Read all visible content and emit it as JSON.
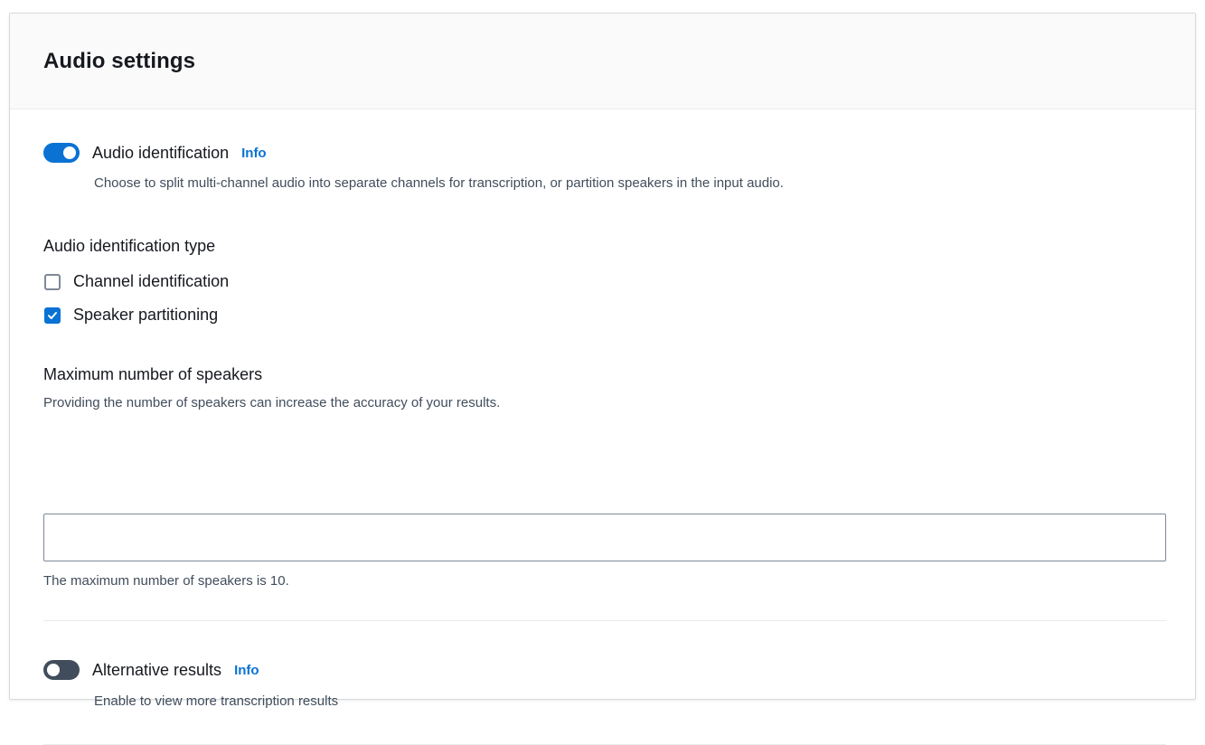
{
  "panel": {
    "title": "Audio settings"
  },
  "audio_identification": {
    "label": "Audio identification",
    "info_label": "Info",
    "description": "Choose to split multi-channel audio into separate channels for transcription, or partition speakers in the input audio.",
    "enabled": true
  },
  "audio_identification_type": {
    "label": "Audio identification type",
    "options": [
      {
        "label": "Channel identification",
        "checked": false
      },
      {
        "label": "Speaker partitioning",
        "checked": true
      }
    ]
  },
  "max_speakers": {
    "label": "Maximum number of speakers",
    "description": "Providing the number of speakers can increase the accuracy of your results.",
    "value": "",
    "placeholder": "",
    "constraint": "The maximum number of speakers is 10."
  },
  "alternative_results": {
    "label": "Alternative results",
    "info_label": "Info",
    "description": "Enable to view more transcription results",
    "enabled": false
  },
  "colors": {
    "accent": "#0972d3",
    "toggle_off": "#414d5c",
    "text_primary": "#16191f",
    "text_secondary": "#414d5c"
  }
}
